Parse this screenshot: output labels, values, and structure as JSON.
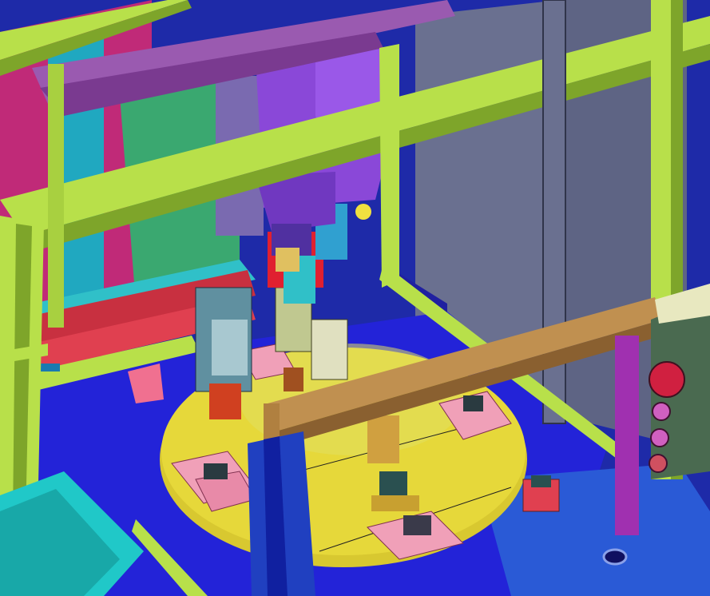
{
  "scene": {
    "subject": "cad-assembly-rotary-indexing-table",
    "palette": {
      "frame_green": "#b8e04a",
      "frame_green_dark": "#7ea52a",
      "turntable_yellow": "#e6d83a",
      "base_blue": "#2323d8",
      "panel_blue": "#2a5ad6",
      "motor_purple": "#8a48d8",
      "fixture_pink": "#f0a0b8",
      "beam_tan": "#c09050",
      "panel_gray": "#6a7090",
      "magenta_wall": "#c02a78",
      "teal_bin": "#20c8c8",
      "control_box": "#4a6a50",
      "button_red": "#d02040",
      "button_pink": "#d060c0"
    },
    "components": [
      "aluminum-frame",
      "overhead-motor",
      "rotary-turntable",
      "part-fixtures",
      "linear-slide",
      "tan-crossbeam",
      "control-box",
      "parts-bin"
    ]
  }
}
